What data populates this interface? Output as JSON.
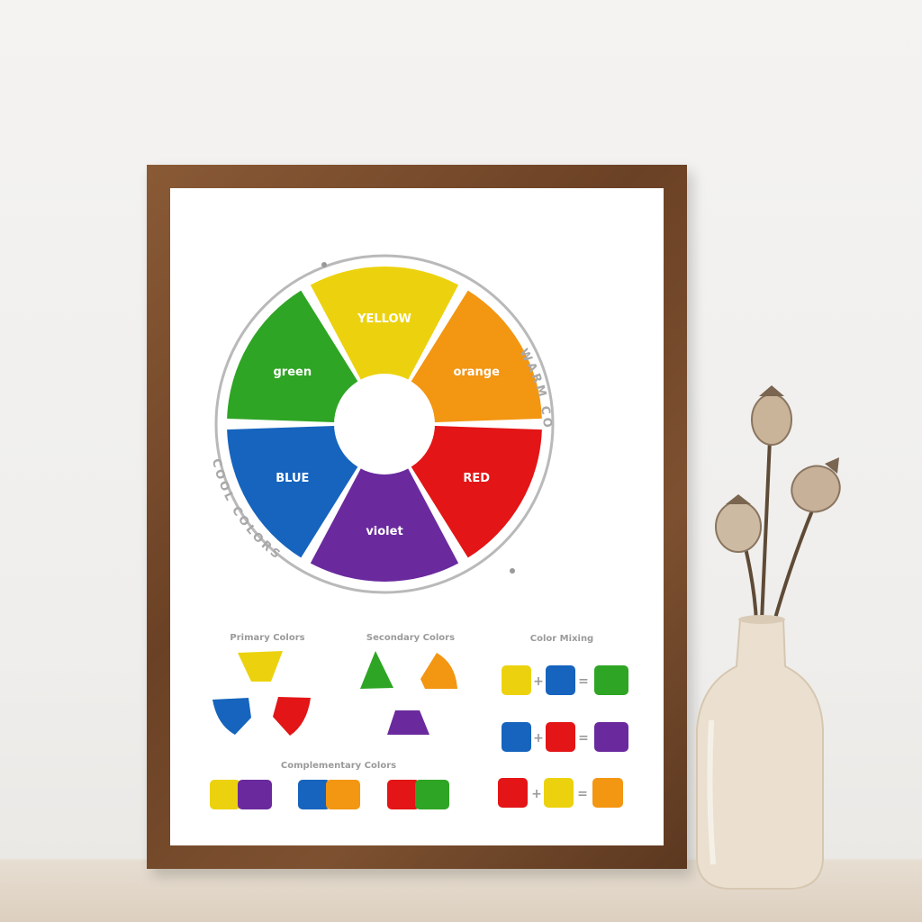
{
  "wheel": {
    "segments": [
      {
        "label": "YELLOW",
        "color": "#ecd20e"
      },
      {
        "label": "orange",
        "color": "#f39612"
      },
      {
        "label": "RED",
        "color": "#e31516"
      },
      {
        "label": "violet",
        "color": "#6a2a9e"
      },
      {
        "label": "BLUE",
        "color": "#1664bd"
      },
      {
        "label": "green",
        "color": "#2ea524"
      }
    ],
    "warm_label": "WARM COLORS",
    "cool_label": "COOL COLORS"
  },
  "sections": {
    "primary_title": "Primary Colors",
    "secondary_title": "Secondary Colors",
    "mixing_title": "Color Mixing",
    "complementary_title": "Complementary Colors"
  },
  "mixing": {
    "plus": "+",
    "equals": "="
  },
  "colors": {
    "frame": "#6b4125",
    "ring": "#b5b5b5",
    "vase": "#e8dccb"
  }
}
